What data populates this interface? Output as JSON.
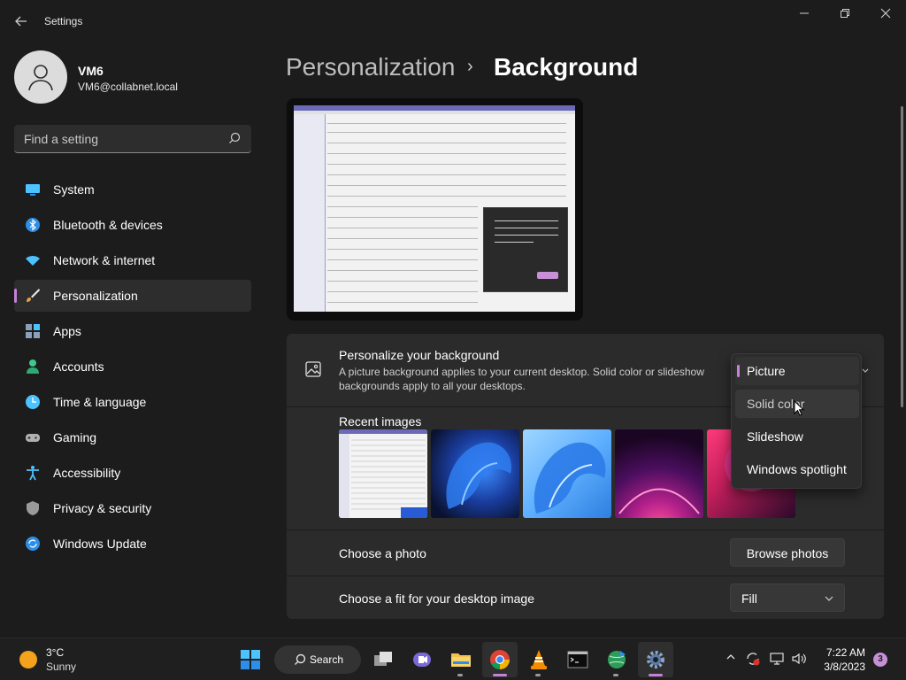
{
  "window": {
    "title": "Settings",
    "back_icon": "arrow-left-icon",
    "controls": [
      "minimize-icon",
      "restore-icon",
      "close-icon"
    ]
  },
  "user": {
    "name": "VM6",
    "email": "VM6@collabnet.local"
  },
  "search": {
    "placeholder": "Find a setting"
  },
  "nav": {
    "items": [
      {
        "label": "System",
        "icon": "system-monitor-icon",
        "color": "#4cc2ff"
      },
      {
        "label": "Bluetooth & devices",
        "icon": "bluetooth-icon",
        "color": "#2c8ee6"
      },
      {
        "label": "Network & internet",
        "icon": "wifi-icon",
        "color": "#4cc2ff"
      },
      {
        "label": "Personalization",
        "icon": "brush-icon",
        "color": "#e6a04a",
        "active": true
      },
      {
        "label": "Apps",
        "icon": "apps-icon",
        "color": "#8aa0b8"
      },
      {
        "label": "Accounts",
        "icon": "person-icon",
        "color": "#3ec88c"
      },
      {
        "label": "Time & language",
        "icon": "clock-globe-icon",
        "color": "#4cc2ff"
      },
      {
        "label": "Gaming",
        "icon": "gamepad-icon",
        "color": "#b0b0b0"
      },
      {
        "label": "Accessibility",
        "icon": "accessibility-icon",
        "color": "#4cc2ff"
      },
      {
        "label": "Privacy & security",
        "icon": "shield-icon",
        "color": "#9a9a9a"
      },
      {
        "label": "Windows Update",
        "icon": "update-icon",
        "color": "#2c8ee6"
      }
    ]
  },
  "header": {
    "parent": "Personalization",
    "separator": "›",
    "title": "Background"
  },
  "background": {
    "title": "Personalize your background",
    "description": "A picture background applies to your current desktop. Solid color or slideshow backgrounds apply to all your desktops.",
    "recent_label": "Recent images",
    "recent_images": [
      "screenshot-thumb",
      "blue-bloom-dark",
      "blue-bloom-light",
      "purple-glow",
      "red-swirl"
    ],
    "choose_photo_label": "Choose a photo",
    "browse_label": "Browse photos",
    "fit_label": "Choose a fit for your desktop image",
    "fit_value": "Fill"
  },
  "dropdown": {
    "options": [
      "Picture",
      "Solid color",
      "Slideshow",
      "Windows spotlight"
    ],
    "selected": "Picture",
    "hovered": "Solid color"
  },
  "taskbar": {
    "weather_temp": "3°C",
    "weather_desc": "Sunny",
    "search_label": "Search",
    "apps": [
      "start-icon",
      "task-view-icon",
      "teams-icon",
      "file-explorer-icon",
      "chrome-icon",
      "vlc-icon",
      "terminal-icon",
      "network-globe-icon",
      "settings-icon"
    ],
    "time": "7:22 AM",
    "date": "3/8/2023",
    "notifications": "3"
  },
  "colors": {
    "accent": "#c680d8",
    "background": "#1c1c1c",
    "card": "#2b2b2b"
  }
}
